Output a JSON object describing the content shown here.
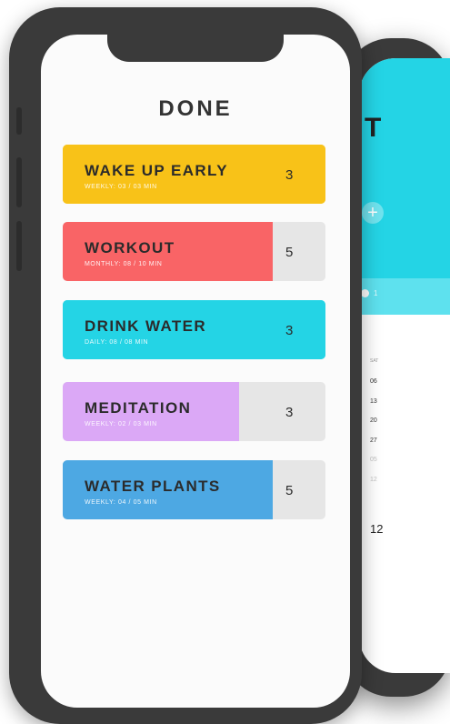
{
  "main": {
    "title": "DONE",
    "habits": [
      {
        "name": "WAKE UP EARLY",
        "subtitle": "WEEKLY: 03 / 03 MIN",
        "count": "3",
        "color": "#f8c218",
        "progress": 1.0
      },
      {
        "name": "WORKOUT",
        "subtitle": "MONTHLY: 08 / 10 MIN",
        "count": "5",
        "color": "#f96466",
        "progress": 0.8
      },
      {
        "name": "DRINK WATER",
        "subtitle": "DAILY: 08 / 08 MIN",
        "count": "3",
        "color": "#24d4e5",
        "progress": 1.0
      },
      {
        "name": "MEDITATION",
        "subtitle": "WEEKLY: 02 / 03 MIN",
        "count": "3",
        "color": "#dba8f6",
        "progress": 0.67
      },
      {
        "name": "WATER PLANTS",
        "subtitle": "WEEKLY: 04 / 05 MIN",
        "count": "5",
        "color": "#4da8e3",
        "progress": 0.8
      }
    ]
  },
  "back_screen": {
    "title": "T",
    "add_icon": "plus-icon",
    "toggle_label": "1",
    "calendar": {
      "weekday": "SAT",
      "days": [
        "06",
        "13",
        "20",
        "27"
      ],
      "faded_days": [
        "05",
        "12"
      ],
      "selected_number": "12"
    }
  }
}
